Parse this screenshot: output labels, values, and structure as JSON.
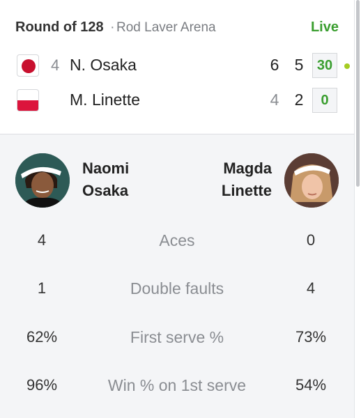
{
  "match": {
    "round": "Round of 128",
    "separator": "·",
    "venue": "Rod Laver Arena",
    "status": "Live"
  },
  "players": [
    {
      "flag": "japan-flag",
      "seed": "4",
      "short_name": "N. Osaka",
      "first_name": "Naomi",
      "last_name": "Osaka",
      "sets": [
        "6",
        "5"
      ],
      "game_points": "30",
      "serving": true
    },
    {
      "flag": "poland-flag",
      "seed": "",
      "short_name": "M. Linette",
      "first_name": "Magda",
      "last_name": "Linette",
      "sets": [
        "4",
        "2"
      ],
      "game_points": "0",
      "serving": false
    }
  ],
  "stats": [
    {
      "label": "Aces",
      "p1": "4",
      "p2": "0"
    },
    {
      "label": "Double faults",
      "p1": "1",
      "p2": "4"
    },
    {
      "label": "First serve %",
      "p1": "62%",
      "p2": "73%"
    },
    {
      "label": "Win % on 1st serve",
      "p1": "96%",
      "p2": "54%"
    }
  ],
  "colors": {
    "live_green": "#3a9e2f",
    "serve_indicator": "#a5cc22",
    "japan_red": "#c8102e",
    "poland_red": "#dc143c"
  }
}
